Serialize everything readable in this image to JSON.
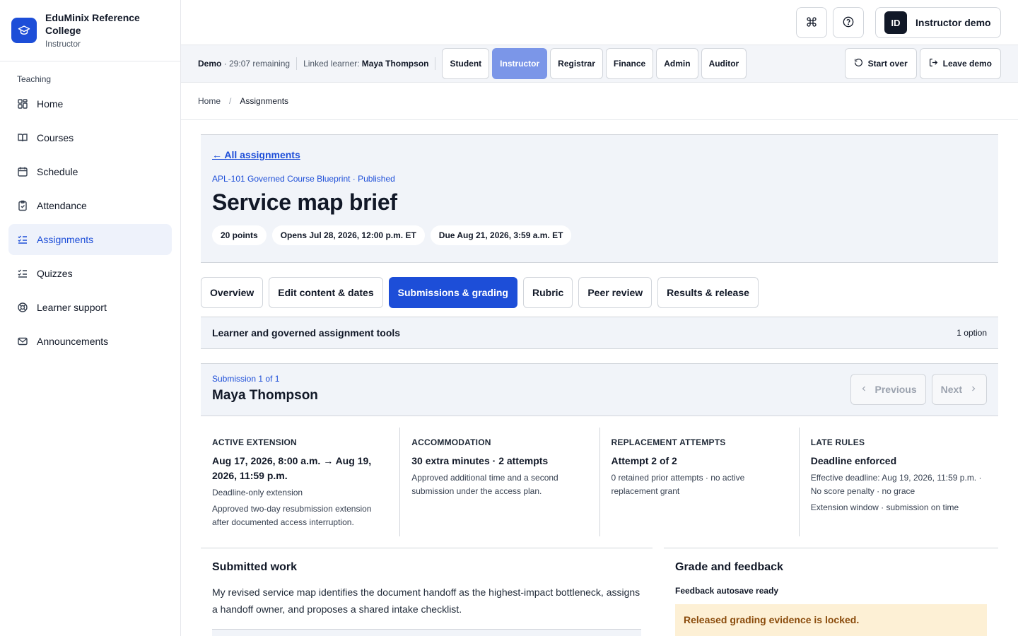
{
  "brand": {
    "name": "EduMinix Reference College",
    "role": "Instructor"
  },
  "sidebar": {
    "section": "Teaching",
    "items": [
      {
        "label": "Home",
        "icon": "grid-icon"
      },
      {
        "label": "Courses",
        "icon": "book-icon"
      },
      {
        "label": "Schedule",
        "icon": "calendar-icon"
      },
      {
        "label": "Attendance",
        "icon": "clipboard-check-icon"
      },
      {
        "label": "Assignments",
        "icon": "list-check-icon",
        "active": true
      },
      {
        "label": "Quizzes",
        "icon": "list-check-icon"
      },
      {
        "label": "Learner support",
        "icon": "lifebuoy-icon"
      },
      {
        "label": "Announcements",
        "icon": "mail-icon"
      }
    ]
  },
  "header": {
    "avatar": "ID",
    "user": "Instructor demo"
  },
  "demo": {
    "label": "Demo",
    "remaining": " · 29:07 remaining",
    "linked_label": "Linked learner: ",
    "linked_name": "Maya Thompson",
    "roles": [
      "Student",
      "Instructor",
      "Registrar",
      "Finance",
      "Admin",
      "Auditor"
    ],
    "active_role": "Instructor",
    "start_over": "Start over",
    "leave": "Leave demo"
  },
  "breadcrumb": {
    "home": "Home",
    "sep": "/",
    "current": "Assignments"
  },
  "assignment": {
    "back": "← All assignments",
    "course": "APL-101 Governed Course Blueprint · Published",
    "title": "Service map brief",
    "chips": [
      "20 points",
      "Opens Jul 28, 2026, 12:00 p.m. ET",
      "Due Aug 21, 2026, 3:59 a.m. ET"
    ]
  },
  "tabs": [
    "Overview",
    "Edit content & dates",
    "Submissions & grading",
    "Rubric",
    "Peer review",
    "Results & release"
  ],
  "tools": {
    "title": "Learner and governed assignment tools",
    "count": "1 option"
  },
  "submission": {
    "count": "Submission 1 of 1",
    "name": "Maya Thompson",
    "previous": "Previous",
    "next": "Next"
  },
  "facts": [
    {
      "label": "ACTIVE EXTENSION",
      "value": "Aug 17, 2026, 8:00 a.m. → Aug 19, 2026, 11:59 p.m.",
      "notes": [
        "Deadline-only extension",
        "Approved two-day resubmission extension after documented access interruption."
      ]
    },
    {
      "label": "ACCOMMODATION",
      "value": "30 extra minutes · 2 attempts",
      "notes": [
        "Approved additional time and a second submission under the access plan."
      ]
    },
    {
      "label": "REPLACEMENT ATTEMPTS",
      "value": "Attempt 2 of 2",
      "notes": [
        "0 retained prior attempts · no active replacement grant"
      ]
    },
    {
      "label": "LATE RULES",
      "value": "Deadline enforced",
      "notes": [
        "Effective deadline: Aug 19, 2026, 11:59 p.m. · No score penalty · no grace",
        "Extension window · submission on time"
      ]
    }
  ],
  "work": {
    "title": "Submitted work",
    "text": "My revised service map identifies the document handoff as the highest-impact bottleneck, assigns a handoff owner, and proposes a shared intake checklist."
  },
  "grade": {
    "title": "Grade and feedback",
    "autosave": "Feedback autosave ready",
    "locked": "Released grading evidence is locked."
  }
}
